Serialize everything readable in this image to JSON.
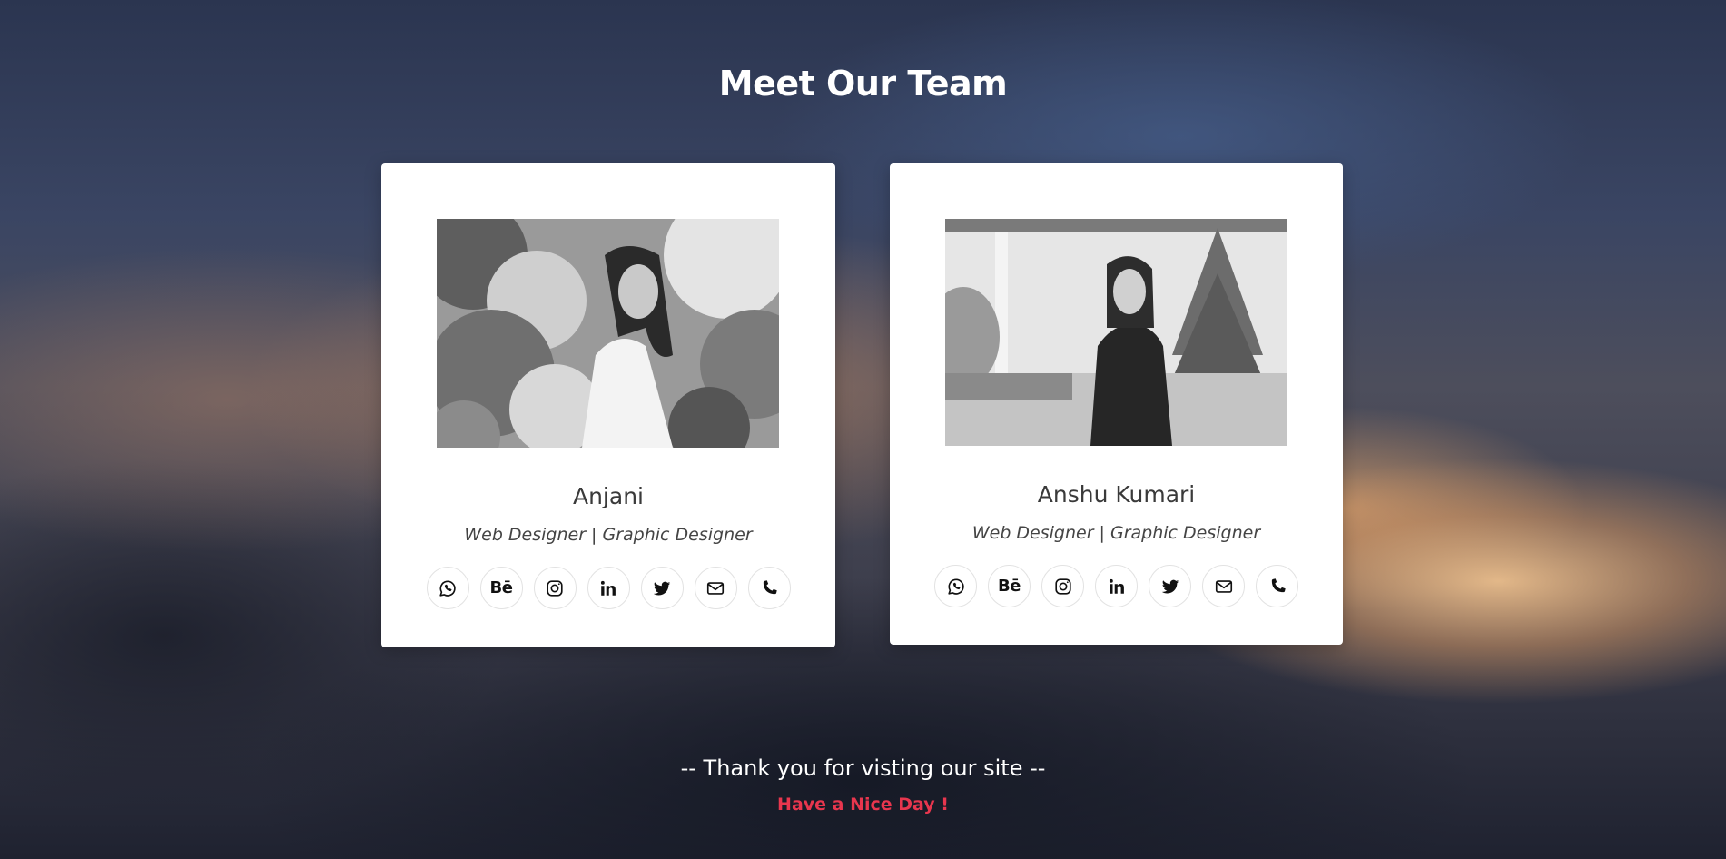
{
  "page": {
    "title": "Meet Our Team"
  },
  "team": [
    {
      "name": "Anjani",
      "role": "Web Designer | Graphic Designer"
    },
    {
      "name": "Anshu Kumari",
      "role": "Web Designer | Graphic Designer"
    }
  ],
  "socials": [
    {
      "icon": "whatsapp-icon"
    },
    {
      "icon": "behance-icon",
      "label": "Bē"
    },
    {
      "icon": "instagram-icon"
    },
    {
      "icon": "linkedin-icon"
    },
    {
      "icon": "twitter-icon"
    },
    {
      "icon": "email-icon"
    },
    {
      "icon": "phone-icon"
    }
  ],
  "footer": {
    "thanks": "-- Thank you for visting our site --",
    "tagline": "Have a Nice Day !"
  },
  "colors": {
    "accent": "#e8364e",
    "card": "#ffffff",
    "heading": "#ffffff"
  }
}
